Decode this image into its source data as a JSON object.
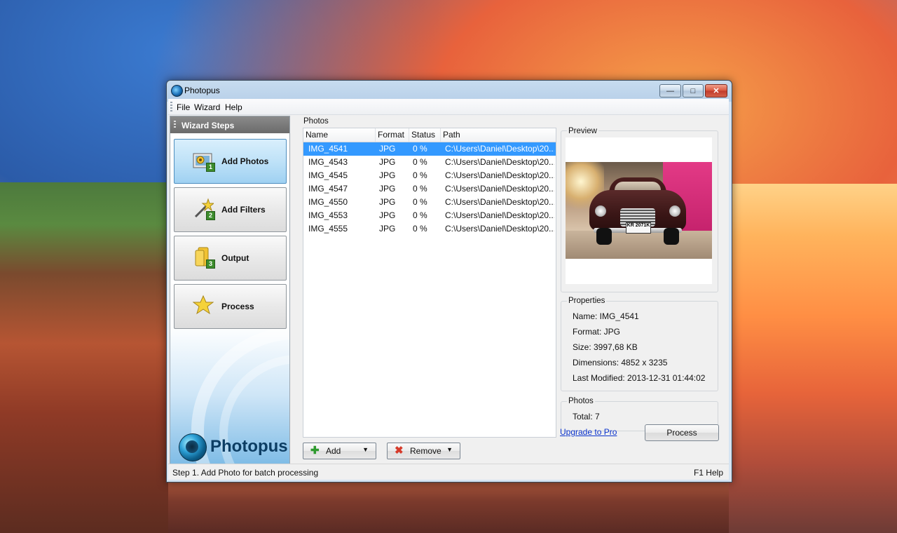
{
  "window": {
    "title": "Photopus"
  },
  "menu": {
    "file": "File",
    "wizard": "Wizard",
    "help": "Help"
  },
  "wizard": {
    "header": "Wizard Steps",
    "steps": [
      {
        "label": "Add Photos",
        "number": "1",
        "icon": "photos-icon",
        "active": true
      },
      {
        "label": "Add Filters",
        "number": "2",
        "icon": "magic-wand-icon",
        "active": false
      },
      {
        "label": "Output",
        "number": "3",
        "icon": "folder-icon",
        "active": false
      },
      {
        "label": "Process",
        "number": "",
        "icon": "star-icon",
        "active": false
      }
    ],
    "logo_text": "Photopus"
  },
  "photos": {
    "group_label": "Photos",
    "columns": {
      "name": "Name",
      "format": "Format",
      "status": "Status",
      "path": "Path"
    },
    "rows": [
      {
        "name": "IMG_4541",
        "format": "JPG",
        "status": "0 %",
        "path": "C:\\Users\\Daniel\\Desktop\\20..."
      },
      {
        "name": "IMG_4543",
        "format": "JPG",
        "status": "0 %",
        "path": "C:\\Users\\Daniel\\Desktop\\20..."
      },
      {
        "name": "IMG_4545",
        "format": "JPG",
        "status": "0 %",
        "path": "C:\\Users\\Daniel\\Desktop\\20..."
      },
      {
        "name": "IMG_4547",
        "format": "JPG",
        "status": "0 %",
        "path": "C:\\Users\\Daniel\\Desktop\\20..."
      },
      {
        "name": "IMG_4550",
        "format": "JPG",
        "status": "0 %",
        "path": "C:\\Users\\Daniel\\Desktop\\20..."
      },
      {
        "name": "IMG_4553",
        "format": "JPG",
        "status": "0 %",
        "path": "C:\\Users\\Daniel\\Desktop\\20..."
      },
      {
        "name": "IMG_4555",
        "format": "JPG",
        "status": "0 %",
        "path": "C:\\Users\\Daniel\\Desktop\\20..."
      }
    ],
    "add_label": "Add",
    "remove_label": "Remove"
  },
  "preview": {
    "label": "Preview",
    "plate": "KR 2071K"
  },
  "properties": {
    "label": "Properties",
    "name": "Name: IMG_4541",
    "format": "Format: JPG",
    "size": "Size: 3997,68 KB",
    "dimensions": "Dimensions: 4852 x 3235",
    "modified": "Last Modified: 2013-12-31 01:44:02"
  },
  "photos_summary": {
    "label": "Photos",
    "total": "Total: 7"
  },
  "upgrade_link": "Upgrade to Pro",
  "process_button": "Process",
  "statusbar": {
    "left": "Step 1. Add Photo for batch processing",
    "right": "F1 Help"
  },
  "colors": {
    "selection": "#3399ff",
    "close_button": "#c0392b",
    "link": "#0b33cc"
  }
}
